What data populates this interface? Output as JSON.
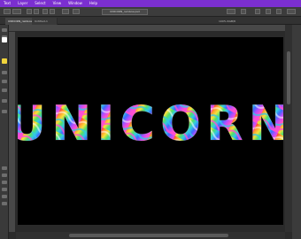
{
  "app": {
    "menu": [
      "Text",
      "Layer",
      "Select",
      "View",
      "Window",
      "Help"
    ],
    "brand_color": "#7b2fd0"
  },
  "options_bar": {
    "document_name": "UNICORN_rainbow.psd"
  },
  "tabs": [
    {
      "label": "UNICORN_rainbow"
    },
    {
      "label": "Untitled-1"
    }
  ],
  "zoom": {
    "label": "100% RGB/8"
  },
  "canvas": {
    "background": "#000000",
    "headline": "UNICORN"
  },
  "headline_fill": {
    "colors": [
      "#ff3b3b",
      "#ff9b2f",
      "#f7e23a",
      "#4fe06b",
      "#32c8e6",
      "#3a6cff",
      "#b14dff",
      "#ff4fd2"
    ]
  },
  "icons": [
    "move-icon",
    "marquee-icon",
    "lasso-icon",
    "crop-icon",
    "eyedropper-icon",
    "brush-icon",
    "eraser-icon",
    "gradient-icon",
    "text-icon",
    "shape-icon",
    "hand-icon",
    "zoom-icon"
  ]
}
